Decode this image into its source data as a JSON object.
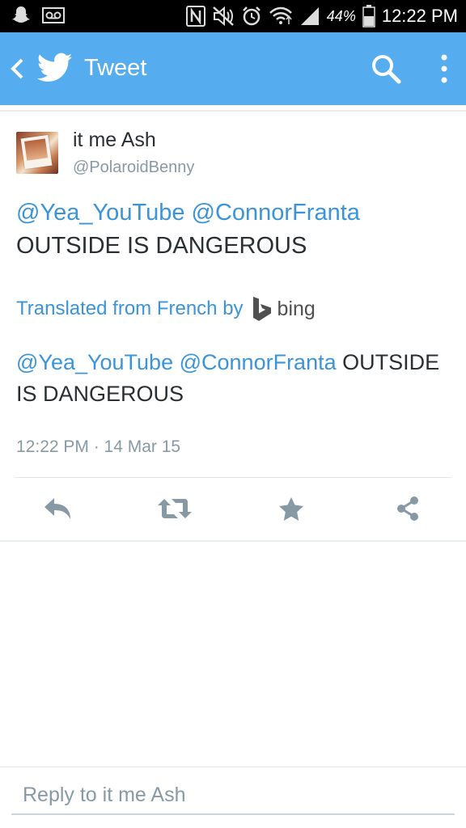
{
  "status_bar": {
    "battery_percent": "44%",
    "time": "12:22 PM",
    "icons": [
      "snapchat-icon",
      "voicemail-icon",
      "nfc-icon",
      "mute-icon",
      "alarm-icon",
      "wifi-icon",
      "signal-icon",
      "battery-icon"
    ]
  },
  "app_bar": {
    "title": "Tweet",
    "color": "#55acee",
    "icons": [
      "back-arrow-icon",
      "twitter-bird-icon",
      "search-icon",
      "overflow-menu-icon"
    ]
  },
  "tweet": {
    "author_name": "it me Ash",
    "author_handle": "@PolaroidBenny",
    "mention_1": "@Yea_YouTube",
    "mention_2": "@ConnorFranta",
    "body": "OUTSIDE IS DANGEROUS",
    "translated_label": "Translated from French by",
    "translator": "bing",
    "translation_mention_1": "@Yea_YouTube",
    "translation_mention_2": "@ConnorFranta",
    "translation_body": "OUTSIDE IS DANGEROUS",
    "timestamp": "12:22 PM · 14 Mar 15"
  },
  "actions": [
    "reply-icon",
    "retweet-icon",
    "favorite-icon",
    "share-icon"
  ],
  "reply": {
    "placeholder": "Reply to it me Ash",
    "value": ""
  },
  "colors": {
    "link": "#3b94d9",
    "text": "#292f33",
    "muted": "#8899a6",
    "action_icon": "#8899a6"
  }
}
